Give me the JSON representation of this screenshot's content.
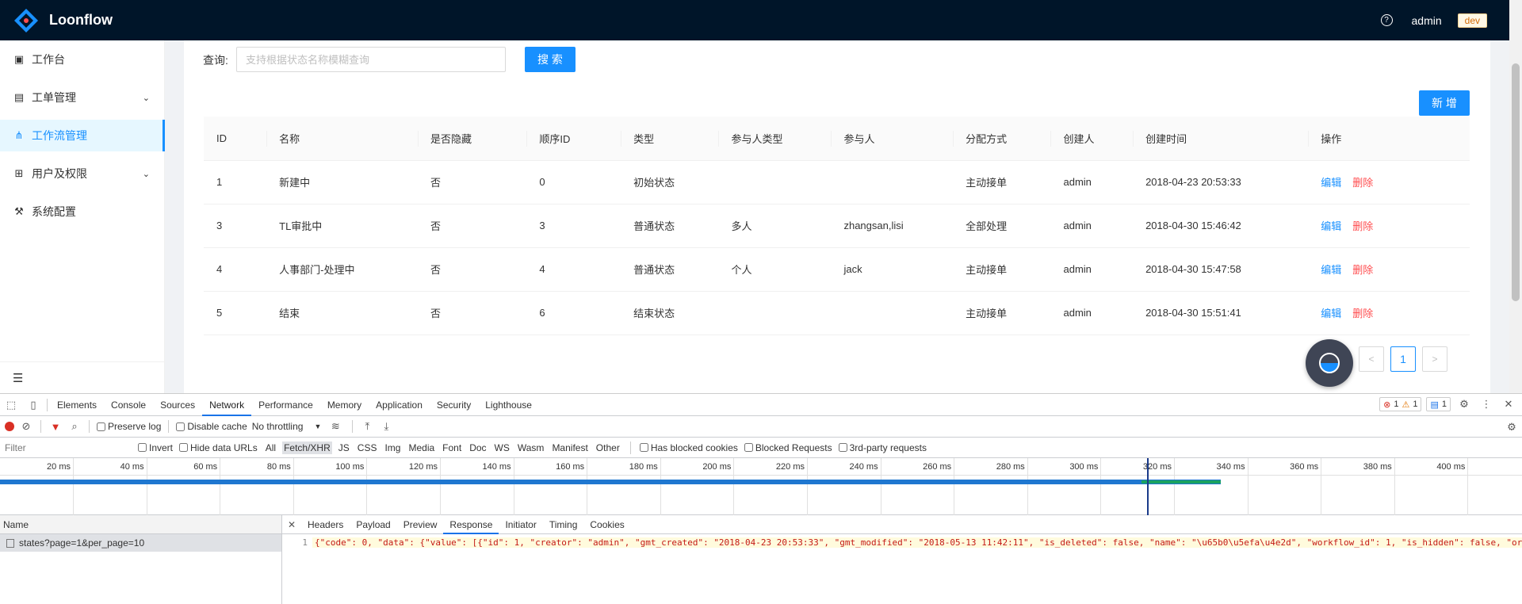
{
  "header": {
    "title": "Loonflow",
    "user": "admin",
    "env": "dev",
    "help_glyph": "?"
  },
  "sidebar": {
    "items": [
      {
        "icon": "calendar-icon",
        "glyph": "▣",
        "label": "工作台",
        "expandable": false,
        "active": false
      },
      {
        "icon": "file-text-icon",
        "glyph": "▤",
        "label": "工单管理",
        "expandable": true,
        "active": false
      },
      {
        "icon": "workflow-icon",
        "glyph": "⋔",
        "label": "工作流管理",
        "expandable": false,
        "active": true
      },
      {
        "icon": "org-tree-icon",
        "glyph": "⊞",
        "label": "用户及权限",
        "expandable": true,
        "active": false
      },
      {
        "icon": "wrench-icon",
        "glyph": "⚒",
        "label": "系统配置",
        "expandable": false,
        "active": false
      }
    ],
    "collapse_glyph": "☰"
  },
  "search": {
    "label": "查询:",
    "placeholder": "支持根据状态名称模糊查询",
    "button": "搜 索"
  },
  "add_button": "新 增",
  "table": {
    "columns": [
      "ID",
      "名称",
      "是否隐藏",
      "顺序ID",
      "类型",
      "参与人类型",
      "参与人",
      "分配方式",
      "创建人",
      "创建时间",
      "操作"
    ],
    "rows": [
      {
        "id": "1",
        "name": "新建中",
        "hidden": "否",
        "order": "0",
        "type": "初始状态",
        "participant_type": "",
        "participant": "",
        "assign": "主动接单",
        "creator": "admin",
        "created": "2018-04-23 20:53:33"
      },
      {
        "id": "3",
        "name": "TL审批中",
        "hidden": "否",
        "order": "3",
        "type": "普通状态",
        "participant_type": "多人",
        "participant": "zhangsan,lisi",
        "assign": "全部处理",
        "creator": "admin",
        "created": "2018-04-30 15:46:42"
      },
      {
        "id": "4",
        "name": "人事部门-处理中",
        "hidden": "否",
        "order": "4",
        "type": "普通状态",
        "participant_type": "个人",
        "participant": "jack",
        "assign": "主动接单",
        "creator": "admin",
        "created": "2018-04-30 15:47:58"
      },
      {
        "id": "5",
        "name": "结束",
        "hidden": "否",
        "order": "6",
        "type": "结束状态",
        "participant_type": "",
        "participant": "",
        "assign": "主动接单",
        "creator": "admin",
        "created": "2018-04-30 15:51:41"
      }
    ],
    "edit_label": "编辑",
    "delete_label": "删除"
  },
  "pagination": {
    "prev": "<",
    "current": "1",
    "next": ">"
  },
  "devtools": {
    "tabs": [
      "Elements",
      "Console",
      "Sources",
      "Network",
      "Performance",
      "Memory",
      "Application",
      "Security",
      "Lighthouse"
    ],
    "active_tab": "Network",
    "errors": "1",
    "warnings": "1",
    "messages": "1",
    "toolbar": {
      "preserve_log": "Preserve log",
      "disable_cache": "Disable cache",
      "throttling": "No throttling"
    },
    "filter": {
      "placeholder": "Filter",
      "invert": "Invert",
      "hide_data_urls": "Hide data URLs",
      "types": [
        "All",
        "Fetch/XHR",
        "JS",
        "CSS",
        "Img",
        "Media",
        "Font",
        "Doc",
        "WS",
        "Wasm",
        "Manifest",
        "Other"
      ],
      "selected_type": "Fetch/XHR",
      "has_blocked_cookies": "Has blocked cookies",
      "blocked_requests": "Blocked Requests",
      "third_party": "3rd-party requests"
    },
    "timeline_ticks": [
      "20 ms",
      "40 ms",
      "60 ms",
      "80 ms",
      "100 ms",
      "120 ms",
      "140 ms",
      "160 ms",
      "180 ms",
      "200 ms",
      "220 ms",
      "240 ms",
      "260 ms",
      "280 ms",
      "300 ms",
      "320 ms",
      "340 ms",
      "360 ms",
      "380 ms",
      "400 ms",
      "4..."
    ],
    "request_list": {
      "header": "Name",
      "requests": [
        "states?page=1&per_page=10"
      ]
    },
    "detail_tabs": [
      "Headers",
      "Payload",
      "Preview",
      "Response",
      "Initiator",
      "Timing",
      "Cookies"
    ],
    "detail_active": "Response",
    "response_line_no": "1",
    "response_text": "{\"code\": 0, \"data\": {\"value\": [{\"id\": 1, \"creator\": \"admin\", \"gmt_created\": \"2018-04-23 20:53:33\", \"gmt_modified\": \"2018-05-13 11:42:11\", \"is_deleted\": false, \"name\": \"\\u65b0\\u5efa\\u4e2d\", \"workflow_id\": 1, \"is_hidden\": false, \"or"
  },
  "colors": {
    "primary": "#1890ff",
    "header_bg": "#001529",
    "danger": "#ff4d4f"
  }
}
